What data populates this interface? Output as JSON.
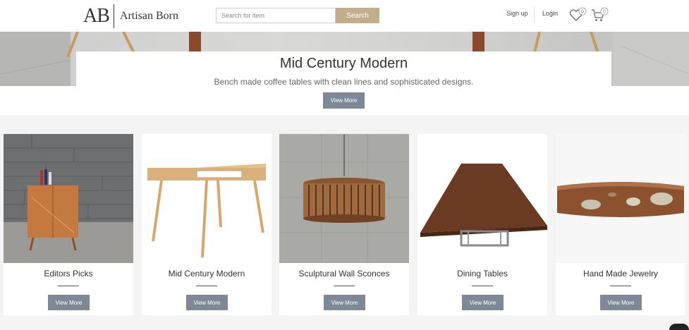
{
  "header": {
    "logo_mark": "AB",
    "logo_name": "Artisan Born",
    "search_placeholder": "Search for item",
    "search_button": "Search",
    "signup": "Sign up",
    "login": "Login",
    "wishlist_count": "0",
    "cart_count": "0",
    "icons": [
      "heart-icon",
      "cart-icon"
    ],
    "accent_color": "#c2ae88"
  },
  "hero": {
    "title": "Mid Century Modern",
    "subtitle": "Bench made coffee tables with clean lines and sophisticated designs.",
    "button": "View More",
    "button_color": "#7d8996"
  },
  "categories": [
    {
      "title": "Editors Picks",
      "button": "View More"
    },
    {
      "title": "Mid Century Modern",
      "button": "View More"
    },
    {
      "title": "Sculptural Wall Sconces",
      "button": "View More"
    },
    {
      "title": "Dining Tables",
      "button": "View More"
    },
    {
      "title": "Hand Made Jewelry",
      "button": "View More"
    }
  ]
}
